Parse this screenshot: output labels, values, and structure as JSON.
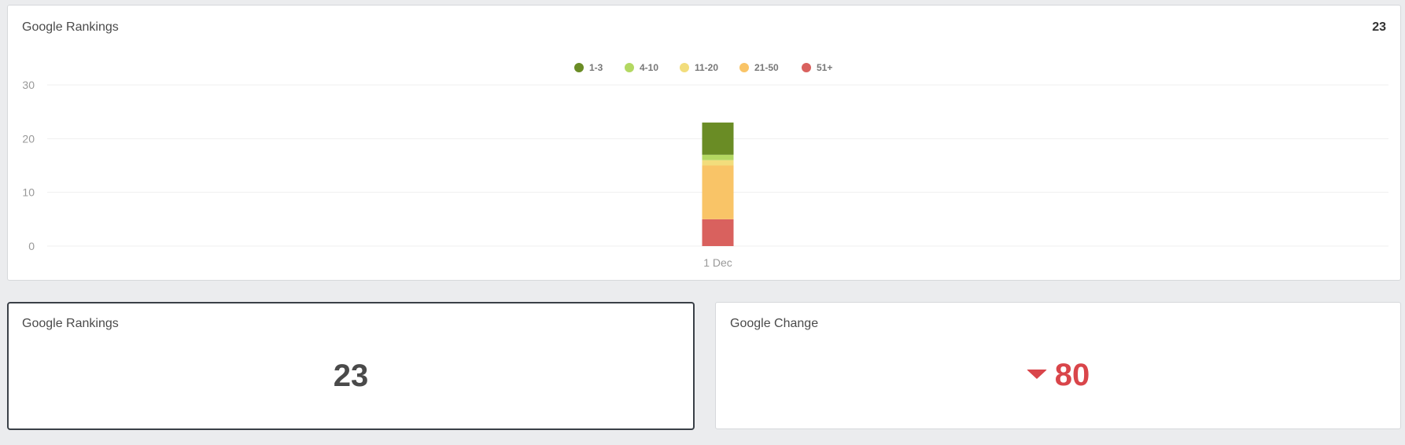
{
  "chart_card": {
    "title": "Google Rankings",
    "total": "23"
  },
  "chart_data": {
    "type": "bar",
    "stacked": true,
    "categories": [
      "1 Dec"
    ],
    "series": [
      {
        "name": "1-3",
        "color": "#6a8c25",
        "values": [
          6
        ]
      },
      {
        "name": "4-10",
        "color": "#b3d862",
        "values": [
          1
        ]
      },
      {
        "name": "11-20",
        "color": "#f2dd7c",
        "values": [
          1
        ]
      },
      {
        "name": "21-50",
        "color": "#f9c467",
        "values": [
          10
        ]
      },
      {
        "name": "51+",
        "color": "#d9615e",
        "values": [
          5
        ]
      }
    ],
    "yticks": [
      "30",
      "20",
      "10",
      "0"
    ],
    "ylim": [
      0,
      30
    ],
    "grid": true,
    "legend_position": "top-center"
  },
  "rank_card": {
    "title": "Google Rankings",
    "value": "23"
  },
  "change_card": {
    "title": "Google Change",
    "value": "80",
    "direction_icon": "caret-down-icon",
    "color": "#d9454a"
  }
}
